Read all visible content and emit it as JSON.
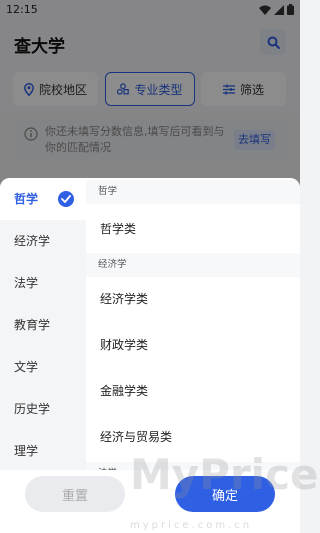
{
  "status": {
    "time": "12:15"
  },
  "header": {
    "title": "查大学"
  },
  "filters": [
    {
      "label": "院校地区"
    },
    {
      "label": "专业类型"
    },
    {
      "label": "筛选"
    }
  ],
  "notice": {
    "text": "你还未填写分数信息,填写后可看到与你的匹配情况",
    "button": "去填写"
  },
  "categories": [
    "哲学",
    "经济学",
    "法学",
    "教育学",
    "文学",
    "历史学",
    "理学"
  ],
  "sections": [
    {
      "title": "哲学",
      "majors": [
        "哲学类"
      ]
    },
    {
      "title": "经济学",
      "majors": [
        "经济学类",
        "财政学类",
        "金融学类",
        "经济与贸易类"
      ]
    },
    {
      "title": "法学"
    }
  ],
  "actions": {
    "reset": "重置",
    "confirm": "确定"
  },
  "watermark": {
    "big": "MyPrice",
    "small": "myprice.com.cn"
  },
  "colors": {
    "accent": "#2f5fe3"
  }
}
